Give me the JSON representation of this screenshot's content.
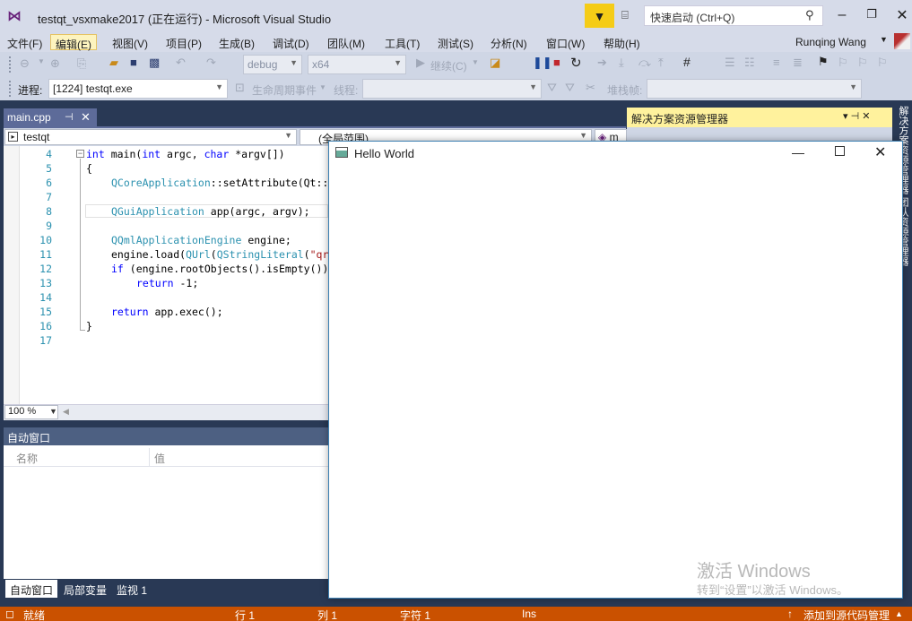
{
  "window": {
    "title": "testqt_vsxmake2017 (正在运行) - Microsoft Visual Studio",
    "quick_launch_placeholder": "快速启动 (Ctrl+Q)"
  },
  "menu": [
    "文件(F)",
    "编辑(E)",
    "视图(V)",
    "项目(P)",
    "生成(B)",
    "调试(D)",
    "团队(M)",
    "工具(T)",
    "测试(S)",
    "分析(N)",
    "窗口(W)",
    "帮助(H)"
  ],
  "user": {
    "name": "Runqing Wang"
  },
  "toolbar": {
    "config": "debug",
    "platform": "x64",
    "continue_label": "继续(C)",
    "process_label": "进程:",
    "process_value": "[1224] testqt.exe",
    "lifecycle_label": "生命周期事件",
    "thread_label": "线程:",
    "stackframe_label": "堆栈帧:"
  },
  "editor": {
    "tab_label": "main.cpp",
    "nav_project": "testqt",
    "nav_scope": "(全局范围)",
    "nav_member": "m",
    "zoom": "100 %",
    "line_numbers": [
      "4",
      "5",
      "6",
      "7",
      "8",
      "9",
      "10",
      "11",
      "12",
      "13",
      "14",
      "15",
      "16",
      "17"
    ]
  },
  "autos": {
    "title": "自动窗口",
    "col_name": "名称",
    "col_value": "值",
    "tabs": [
      "自动窗口",
      "局部变量",
      "监视 1"
    ]
  },
  "solution_explorer": {
    "title": "解决方案资源管理器",
    "side_tab": "解决方案资源管理器 团队资源管理器"
  },
  "qt_window": {
    "title": "Hello World"
  },
  "watermark": {
    "line1": "激活 Windows",
    "line2": "转到“设置”以激活 Windows。"
  },
  "status": {
    "ready": "就绪",
    "line": "行 1",
    "col": "列 1",
    "ch": "字符 1",
    "ins": "Ins",
    "source_control": "添加到源代码管理"
  },
  "colors": {
    "status_bar": "#ca5100",
    "tab_well": "#293955",
    "accent_tab": "#5d6b99",
    "notification": "#f5cc17"
  }
}
